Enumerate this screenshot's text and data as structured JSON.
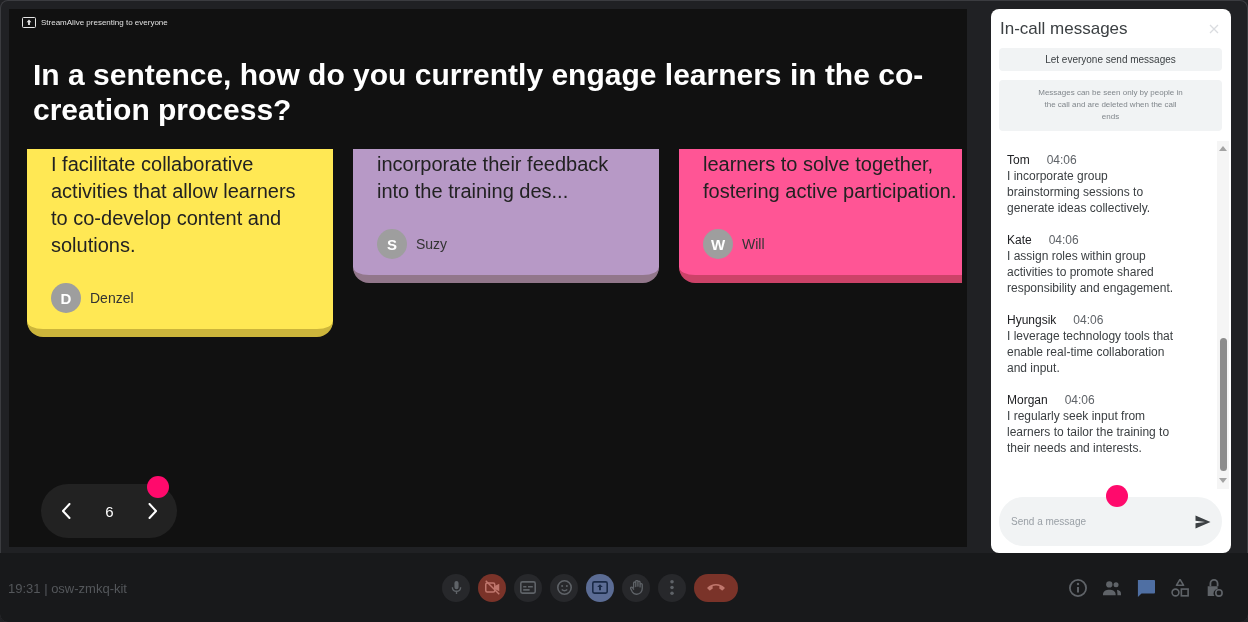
{
  "presentation": {
    "presenter_label": "StreamAlive presenting to everyone",
    "question": "In a sentence, how do you currently engage learners in the co-creation process?",
    "cards": [
      {
        "text": "I facilitate collaborative activities that allow learners to co-develop content and solutions.",
        "initial": "D",
        "author": "Denzel",
        "color": "#ffe854"
      },
      {
        "text": "incorporate their feedback into the training des...",
        "initial": "S",
        "author": "Suzy",
        "color": "#b799c6"
      },
      {
        "text": "learners to solve together, fostering active participation.",
        "initial": "W",
        "author": "Will",
        "color": "#ff5595"
      }
    ],
    "pager": {
      "page": "6"
    }
  },
  "chat": {
    "title": "In-call messages",
    "toggle_label": "Let everyone send messages",
    "notice": "Messages can be seen only by people in the call and are deleted when the call ends",
    "messages": [
      {
        "sender": "Tom",
        "time": "04:06",
        "text": "I incorporate group brainstorming sessions to generate ideas collectively."
      },
      {
        "sender": "Kate",
        "time": "04:06",
        "text": "I assign roles within group activities to promote shared responsibility and engagement."
      },
      {
        "sender": "Hyungsik",
        "time": "04:06",
        "text": "I leverage technology tools that enable real-time collaboration and input."
      },
      {
        "sender": "Morgan",
        "time": "04:06",
        "text": "I regularly seek input from learners to tailor the training to their needs and interests."
      }
    ],
    "input": {
      "placeholder": "Send a message"
    }
  },
  "bottom_bar": {
    "meeting_info": "19:31 | osw-zmkq-kit",
    "controls": [
      {
        "kind": "mic",
        "on": true
      },
      {
        "kind": "camera",
        "on": false
      },
      {
        "kind": "captions",
        "on": false
      },
      {
        "kind": "reactions",
        "on": false
      },
      {
        "kind": "present",
        "on": true
      },
      {
        "kind": "hand",
        "on": false
      },
      {
        "kind": "more",
        "on": false
      },
      {
        "kind": "hangup",
        "on": true
      }
    ],
    "panels": [
      {
        "kind": "info",
        "selected": false
      },
      {
        "kind": "people",
        "selected": false
      },
      {
        "kind": "chat",
        "selected": true
      },
      {
        "kind": "activities",
        "selected": false
      },
      {
        "kind": "host",
        "selected": false
      }
    ]
  }
}
